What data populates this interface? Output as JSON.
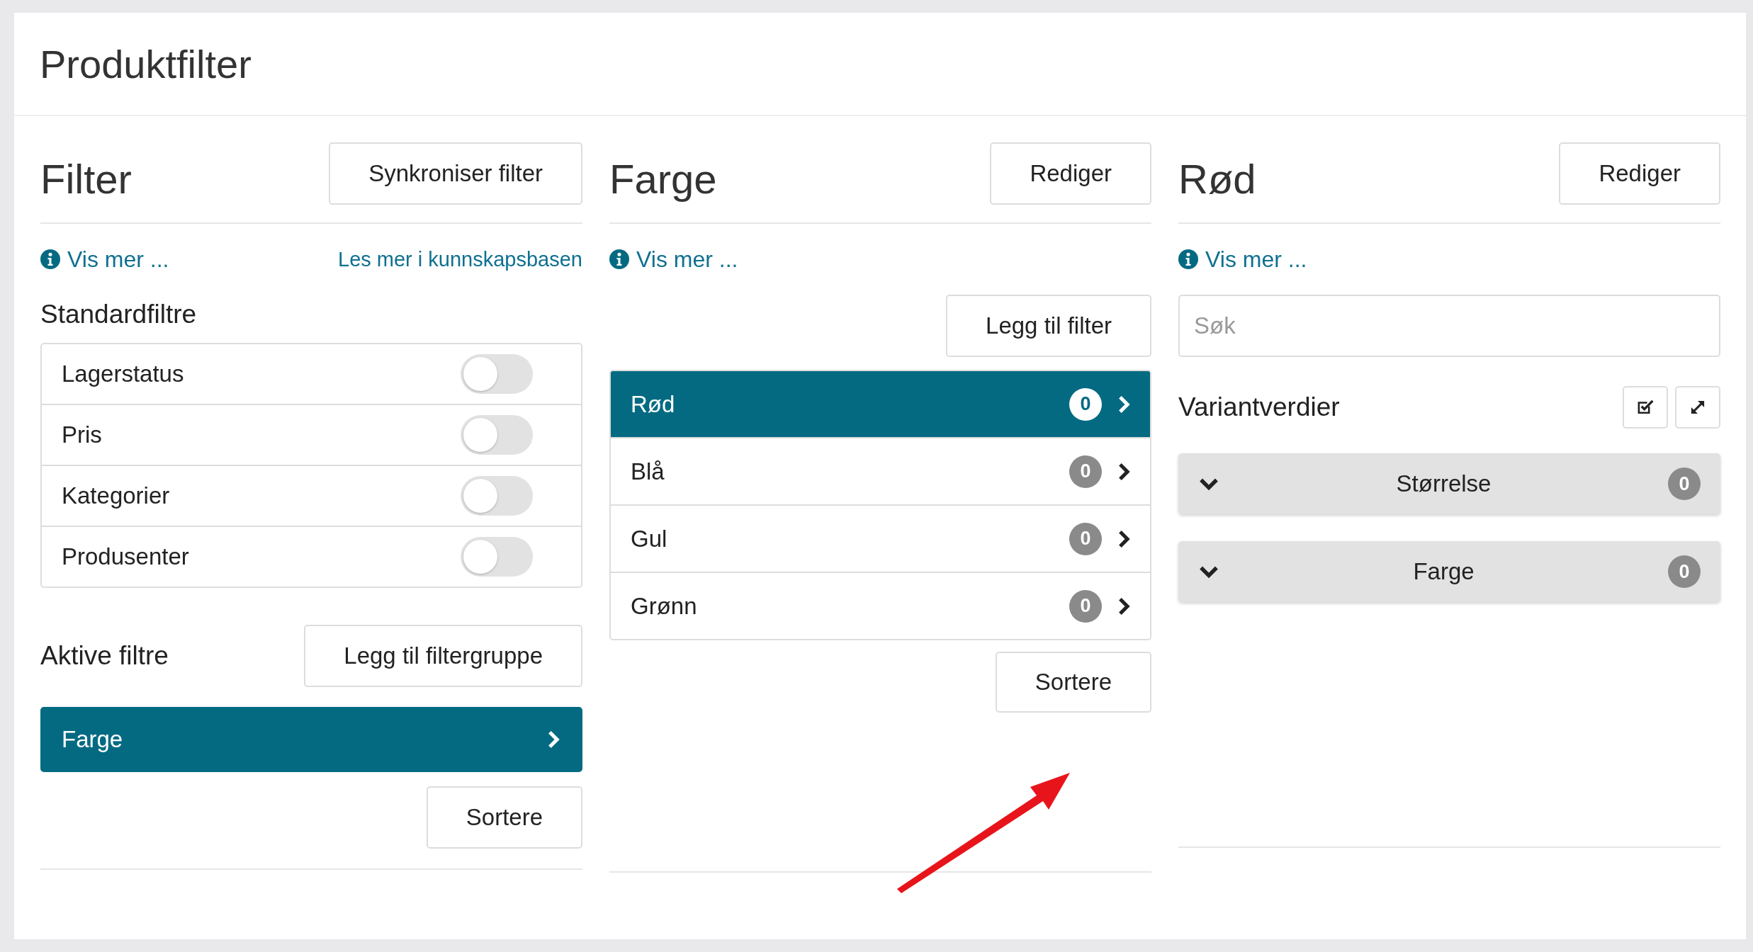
{
  "page": {
    "title": "Produktfilter"
  },
  "filter_panel": {
    "title": "Filter",
    "sync_button": "Synkroniser filter",
    "info_link": "Vis mer ...",
    "kb_link": "Les mer i kunnskapsbasen",
    "standard_heading": "Standardfiltre",
    "standard_filters": [
      {
        "label": "Lagerstatus",
        "on": false
      },
      {
        "label": "Pris",
        "on": false
      },
      {
        "label": "Kategorier",
        "on": false
      },
      {
        "label": "Produsenter",
        "on": false
      }
    ],
    "active_heading": "Aktive filtre",
    "add_group_button": "Legg til filtergruppe",
    "active_filters": [
      {
        "label": "Farge",
        "selected": true
      }
    ],
    "sort_button": "Sortere"
  },
  "value_panel": {
    "title": "Farge",
    "edit_button": "Rediger",
    "info_link": "Vis mer ...",
    "add_button": "Legg til filter",
    "values": [
      {
        "label": "Rød",
        "count": "0",
        "selected": true
      },
      {
        "label": "Blå",
        "count": "0",
        "selected": false
      },
      {
        "label": "Gul",
        "count": "0",
        "selected": false
      },
      {
        "label": "Grønn",
        "count": "0",
        "selected": false
      }
    ],
    "sort_button": "Sortere"
  },
  "detail_panel": {
    "title": "Rød",
    "edit_button": "Rediger",
    "info_link": "Vis mer ...",
    "search": {
      "placeholder": "Søk"
    },
    "variants_heading": "Variantverdier",
    "groups": [
      {
        "label": "Størrelse",
        "count": "0"
      },
      {
        "label": "Farge",
        "count": "0"
      }
    ]
  }
}
